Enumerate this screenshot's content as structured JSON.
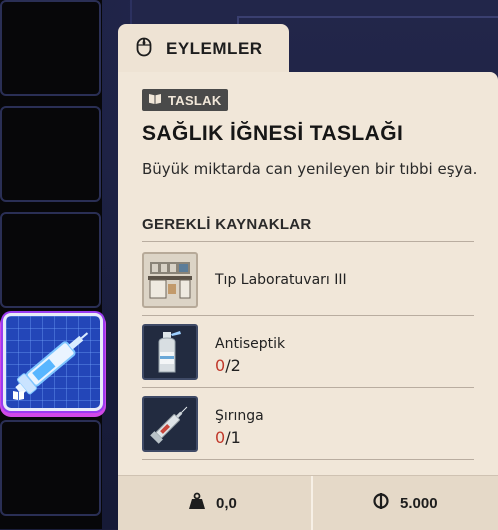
{
  "tab": {
    "icon": "mouse-icon",
    "label": "EYLEMLER"
  },
  "badge": {
    "icon": "open-book-icon",
    "label": "TASLAK"
  },
  "item": {
    "title": "SAĞLIK İĞNESİ TASLAĞI",
    "description": "Büyük miktarda can yenileyen bir tıbbi eşya."
  },
  "resources": {
    "heading": "GEREKLİ KAYNAKLAR",
    "items": [
      {
        "name": "Tıp Laboratuvarı III",
        "icon": "medical-lab-icon",
        "have": "",
        "sep": "",
        "need": ""
      },
      {
        "name": "Antiseptik",
        "icon": "antiseptic-bottle-icon",
        "have": "0",
        "sep": "/",
        "need": "2"
      },
      {
        "name": "Şırınga",
        "icon": "syringe-icon",
        "have": "0",
        "sep": "/",
        "need": "1"
      }
    ]
  },
  "footer": {
    "weight": {
      "icon": "weight-icon",
      "value": "0,0"
    },
    "price": {
      "icon": "currency-icon",
      "value": "5.000"
    }
  },
  "inventory": {
    "selected_icon": "blueprint-syringe-icon",
    "slot_badge_icon": "open-book-icon"
  },
  "colors": {
    "missing": "#c1392b",
    "card": "#f1e7d9",
    "slot_selected": "#2346b8"
  }
}
